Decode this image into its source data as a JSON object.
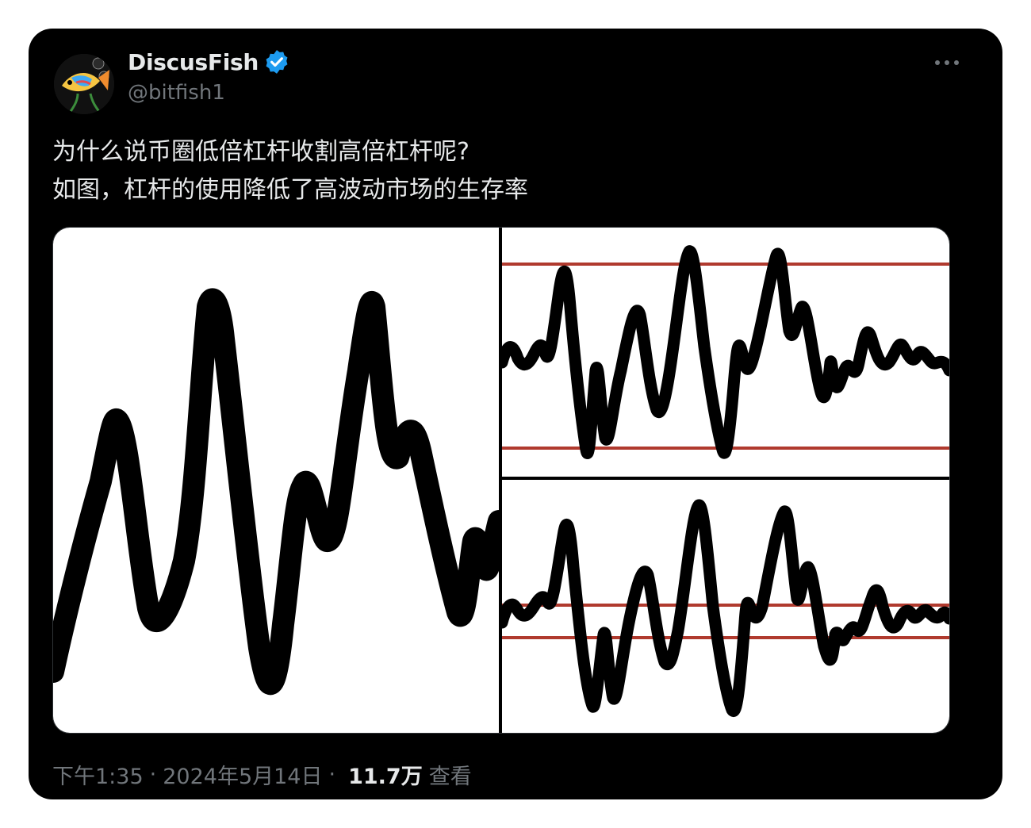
{
  "tweet": {
    "display_name": "DiscusFish",
    "handle": "@bitfish1",
    "verified_icon": "verified-badge-icon",
    "more_icon": "more-horizontal-icon",
    "text_lines": [
      "为什么说币圈低倍杠杆收割高倍杠杆呢?",
      "如图，杠杆的使用降低了高波动市场的生存率"
    ],
    "time": "下午1:35",
    "dot": "·",
    "date": "2024年5月14日",
    "views_count": "11.7万",
    "views_label": "查看"
  },
  "colors": {
    "background": "#000000",
    "text": "#e7e9ea",
    "muted": "#71767b",
    "verified": "#1d9bf0",
    "leverage_line": "#b03a2e"
  }
}
